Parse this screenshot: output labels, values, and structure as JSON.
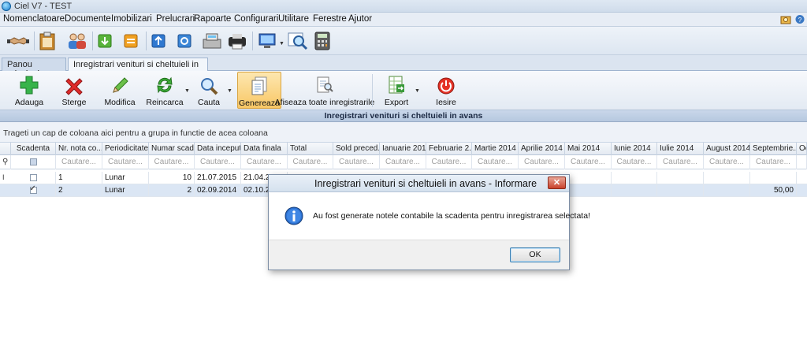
{
  "window": {
    "title": "Ciel V7 - TEST"
  },
  "menu": {
    "items": [
      "Nomenclatoare",
      "Documente",
      "Imobilizari",
      "Prelucrari",
      "Rapoarte",
      "Configurari",
      "Utilitare",
      "Ferestre",
      "Ajutor"
    ]
  },
  "tabs": [
    {
      "label": "Panou principal"
    },
    {
      "label": "Inregistrari venituri si cheltuieli in avans",
      "close": "✕"
    }
  ],
  "ribbon": {
    "add": "Adauga",
    "delete": "Sterge",
    "edit": "Modifica",
    "reload": "Reincarca",
    "search": "Cauta",
    "generate": "Genereaza",
    "show_all": "Afiseaza toate inregistrarile",
    "export": "Export",
    "exit": "Iesire"
  },
  "grid": {
    "caption": "Inregistrari venituri si cheltuieli in avans",
    "group_hint": "Trageti un cap de coloana aici pentru a grupa in functie de acea coloana",
    "filter_placeholder": "Cautare...",
    "columns": [
      "Scadenta",
      "Nr. nota co...",
      "Periodicitate",
      "Numar scad...",
      "Data inceput",
      "Data finala",
      "Total",
      "Sold preced...",
      "Ianuarie 2014",
      "Februarie 2...",
      "Martie 2014",
      "Aprilie 2014",
      "Mai 2014",
      "Iunie 2014",
      "Iulie 2014",
      "August 2014",
      "Septembrie...",
      "Oc"
    ],
    "rows": [
      {
        "indicator": "I",
        "checked": false,
        "nr": "1",
        "periodicitate": "Lunar",
        "numar": "10",
        "inceput": "21.07.2015",
        "finala": "21.04.2",
        "septembrie": ""
      },
      {
        "indicator": "",
        "checked": true,
        "nr": "2",
        "periodicitate": "Lunar",
        "numar": "2",
        "inceput": "02.09.2014",
        "finala": "02.10.2",
        "septembrie": "50,00"
      }
    ]
  },
  "dialog": {
    "title": "Inregistrari venituri si cheltuieli in avans - Informare",
    "close": "✕",
    "message": "Au fost generate notele contabile la scadenta pentru inregistrarea selectata!",
    "ok": "OK"
  }
}
